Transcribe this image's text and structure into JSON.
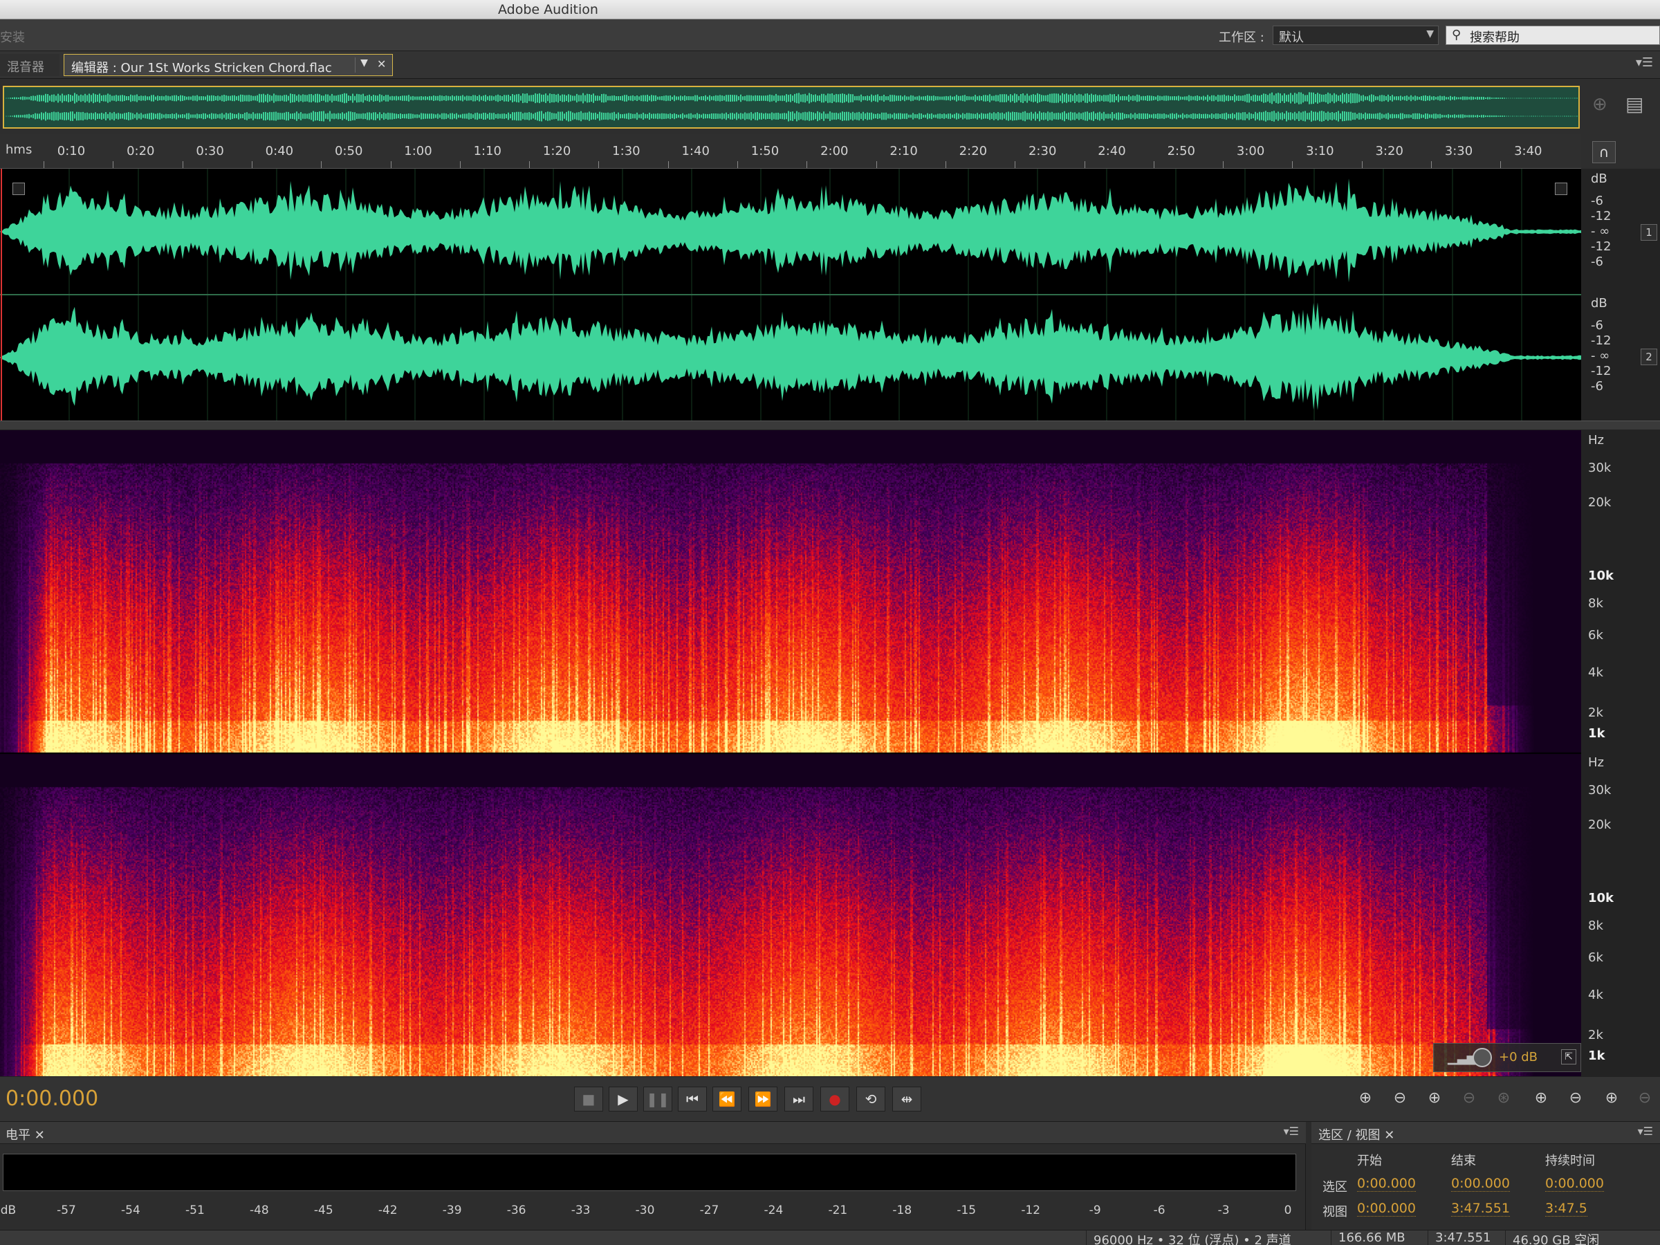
{
  "app": {
    "title": "Adobe Audition"
  },
  "workspace": {
    "left_stub": "安装",
    "label": "工作区 :",
    "value": "默认",
    "help_placeholder": "搜索帮助"
  },
  "tabs": {
    "mixer": "混音器",
    "editor": "编辑器 : Our 1St Works Stricken Chord.flac"
  },
  "ruler": {
    "unit": "hms",
    "ticks": [
      "0:10",
      "0:20",
      "0:30",
      "0:40",
      "0:50",
      "1:00",
      "1:10",
      "1:20",
      "1:30",
      "1:40",
      "1:50",
      "2:00",
      "2:10",
      "2:20",
      "2:30",
      "2:40",
      "2:50",
      "3:00",
      "3:10",
      "3:20",
      "3:30",
      "3:40"
    ]
  },
  "db_scale": {
    "unit": "dB",
    "labels": [
      "-6",
      "-12",
      "- ∞",
      "-12",
      "-6"
    ],
    "channels": [
      "1",
      "2"
    ]
  },
  "hz_scale": {
    "unit": "Hz",
    "labels": [
      "30k",
      "20k",
      "10k",
      "8k",
      "6k",
      "4k",
      "2k",
      "1k"
    ]
  },
  "gain": {
    "value": "+0 dB"
  },
  "transport": {
    "timecode": "0:00.000"
  },
  "levels": {
    "title": "电平",
    "ticks": [
      "dB",
      "-57",
      "-54",
      "-51",
      "-48",
      "-45",
      "-42",
      "-39",
      "-36",
      "-33",
      "-30",
      "-27",
      "-24",
      "-21",
      "-18",
      "-15",
      "-12",
      "-9",
      "-6",
      "-3",
      "0"
    ]
  },
  "selection": {
    "title": "选区 / 视图",
    "col_start": "开始",
    "col_end": "结束",
    "col_duration": "持续时间",
    "row_selection": "选区",
    "row_view": "视图",
    "sel_start": "0:00.000",
    "sel_end": "0:00.000",
    "sel_dur": "0:00.000",
    "view_start": "0:00.000",
    "view_end": "3:47.551",
    "view_dur": "3:47.5"
  },
  "status": {
    "format": "96000 Hz • 32 位 (浮点) • 2 声道",
    "size": "166.66 MB",
    "duration": "3:47.551",
    "free": "46.90 GB 空闲"
  },
  "colors": {
    "waveform": "#3ed49a",
    "timecode": "#d7a138",
    "accent": "#d9b23e"
  }
}
